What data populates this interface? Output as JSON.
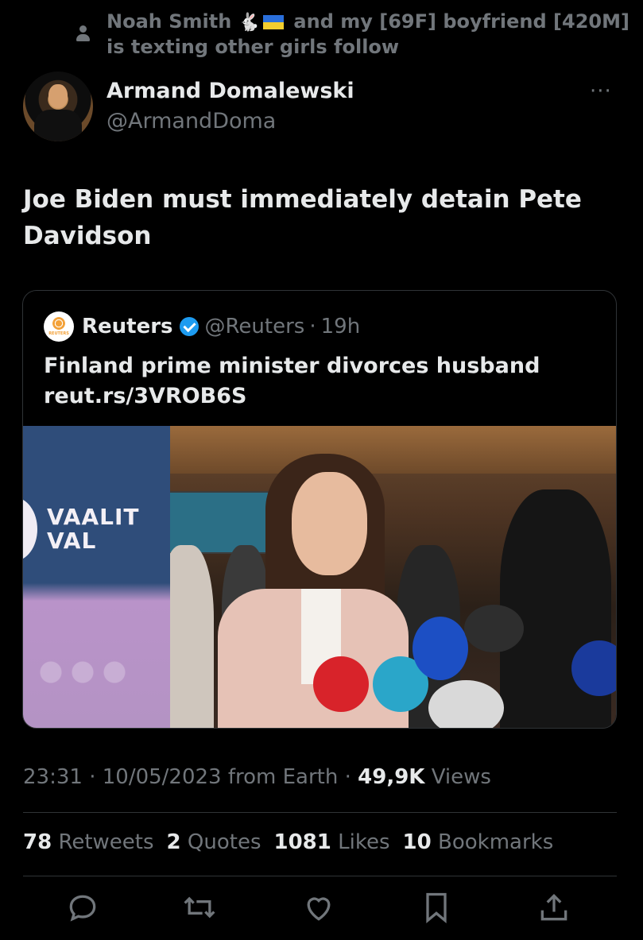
{
  "context": {
    "icon": "person-icon",
    "line1_name": "Noah Smith",
    "line1_rest": "and my [69F] boyfriend [420M]",
    "line2": "is texting other girls follow"
  },
  "author": {
    "name": "Armand Domalewski",
    "handle": "@ArmandDoma",
    "more_icon": "more-icon",
    "more_label": "···"
  },
  "tweet": {
    "text": "Joe Biden must immediately detain Pete Davidson"
  },
  "quote": {
    "logo_text": "REUTERS",
    "name": "Reuters",
    "handle": "@Reuters",
    "separator": "·",
    "time": "19h",
    "text_line1": "Finland prime minister divorces husband",
    "text_line2": "reut.rs/3VROB6S",
    "image": {
      "banner_line1": "VAALIT",
      "banner_line2": "VAL"
    }
  },
  "meta": {
    "time": "23:31",
    "date": "10/05/2023",
    "source": "from Earth",
    "views_count": "49,9K",
    "views_label": "Views"
  },
  "stats": {
    "retweets_count": "78",
    "retweets_label": "Retweets",
    "quotes_count": "2",
    "quotes_label": "Quotes",
    "likes_count": "1081",
    "likes_label": "Likes",
    "bookmarks_count": "10",
    "bookmarks_label": "Bookmarks"
  },
  "colors": {
    "background": "#000000",
    "text": "#e7e9ea",
    "muted": "#71767b",
    "verified": "#1d9bf0"
  }
}
